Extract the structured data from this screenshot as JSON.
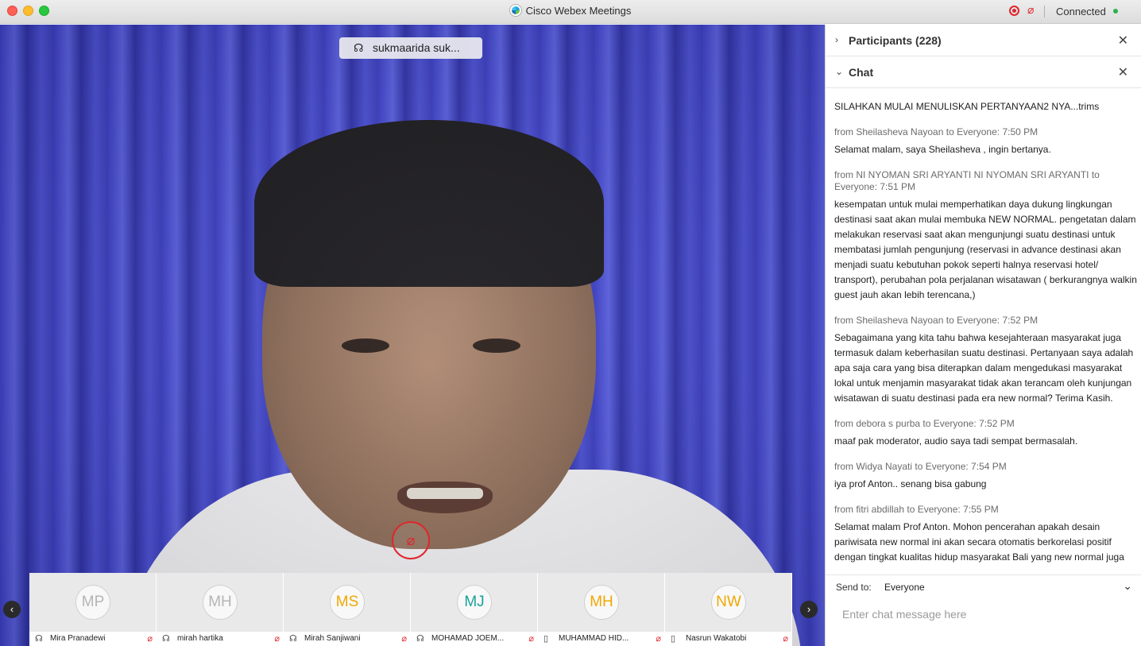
{
  "window": {
    "title": "Cisco Webex Meetings",
    "status": "Connected",
    "recording_icon": "record-icon",
    "mic_icon": "muted-mic-icon"
  },
  "video": {
    "active_speaker": "sukmaarida suk...",
    "speaker_icon": "headset-icon",
    "center_mute_icon": "muted-mic-icon"
  },
  "thumbnails": [
    {
      "initials": "MP",
      "name": "Mira Pranadewi",
      "initials_color": "#b5b5b5",
      "device_icon": "headset-icon"
    },
    {
      "initials": "MH",
      "name": "mirah hartika",
      "initials_color": "#b5b5b5",
      "device_icon": "headset-icon"
    },
    {
      "initials": "MS",
      "name": "Mirah Sanjiwani",
      "initials_color": "#f0a800",
      "device_icon": "headset-icon"
    },
    {
      "initials": "MJ",
      "name": "MOHAMAD JOEM...",
      "initials_color": "#1aa39a",
      "device_icon": "headset-icon"
    },
    {
      "initials": "MH",
      "name": "MUHAMMAD HID...",
      "initials_color": "#f0a800",
      "device_icon": "phone-icon"
    },
    {
      "initials": "NW",
      "name": "Nasrun Wakatobi",
      "initials_color": "#f0a800",
      "device_icon": "phone-icon"
    }
  ],
  "panel": {
    "participants_title": "Participants (228)",
    "chat_title": "Chat",
    "messages": [
      {
        "meta": "",
        "text": "SILAHKAN MULAI MENULISKAN PERTANYAAN2 NYA...trims"
      },
      {
        "meta": "from Sheilasheva Nayoan to Everyone:   7:50  PM",
        "text": "Selamat malam, saya Sheilasheva , ingin bertanya."
      },
      {
        "meta": "from NI NYOMAN SRI ARYANTI NI NYOMAN SRI ARYANTI to Everyone:   7:51  PM",
        "text": "kesempatan untuk mulai memperhatikan daya dukung lingkungan destinasi saat akan mulai membuka NEW NORMAL. pengetatan dalam melakukan reservasi saat akan mengunjungi suatu destinasi untuk membatasi jumlah pengunjung (reservasi in advance destinasi akan menjadi suatu kebutuhan pokok seperti halnya reservasi hotel/ transport), perubahan pola perjalanan wisatawan ( berkurangnya walkin guest jauh akan lebih terencana,)"
      },
      {
        "meta": "from Sheilasheva Nayoan to Everyone:   7:52  PM",
        "text": "Sebagaimana yang kita tahu bahwa kesejahteraan masyarakat juga termasuk dalam keberhasilan suatu destinasi. Pertanyaan saya adalah apa saja cara yang bisa diterapkan dalam mengedukasi masyarakat lokal untuk menjamin masyarakat tidak akan terancam oleh kunjungan wisatawan di suatu destinasi pada era new normal? Terima Kasih."
      },
      {
        "meta": "from debora s purba to Everyone:   7:52  PM",
        "text": "maaf pak moderator, audio saya tadi sempat bermasalah."
      },
      {
        "meta": "from Widya Nayati to Everyone:   7:54  PM",
        "text": "iya prof Anton.. senang bisa gabung"
      },
      {
        "meta": "from fitri abdillah to Everyone:   7:55  PM",
        "text": "Selamat malam Prof Anton.  Mohon pencerahan apakah desain pariwisata new normal ini akan secara otomatis berkorelasi positif dengan tingkat kualitas hidup masyarakat Bali yang new normal juga"
      }
    ],
    "send_to_label": "Send to:",
    "send_to_value": "Everyone",
    "input_placeholder": "Enter chat message here"
  }
}
